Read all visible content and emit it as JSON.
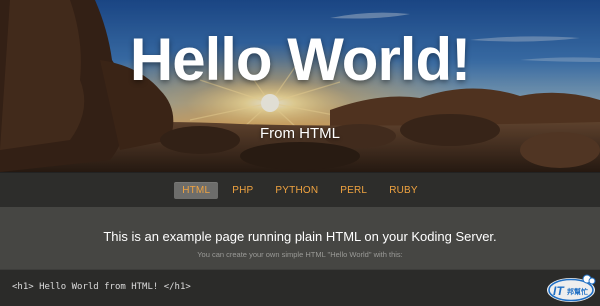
{
  "hero": {
    "title": "Hello World!",
    "subtitle": "From HTML"
  },
  "nav": {
    "items": [
      {
        "label": "HTML",
        "active": true
      },
      {
        "label": "PHP",
        "active": false
      },
      {
        "label": "PYTHON",
        "active": false
      },
      {
        "label": "PERL",
        "active": false
      },
      {
        "label": "RUBY",
        "active": false
      }
    ]
  },
  "content": {
    "lead": "This is an example page running plain HTML on your Koding Server.",
    "sublead": "You can create your own simple HTML \"Hello World\" with this:"
  },
  "code": {
    "snippet": "<h1> Hello World from HTML! </h1>"
  },
  "watermark": {
    "text": "iT邦幫忙",
    "logo_mark": "IT"
  },
  "colors": {
    "nav_link": "#f0a340",
    "nav_active_bg": "#6d6d6b",
    "nav_bg": "#2d2d2b",
    "content_bg": "#464643",
    "code_bg": "#2b2b29",
    "watermark_blue": "#1f6fc4"
  }
}
